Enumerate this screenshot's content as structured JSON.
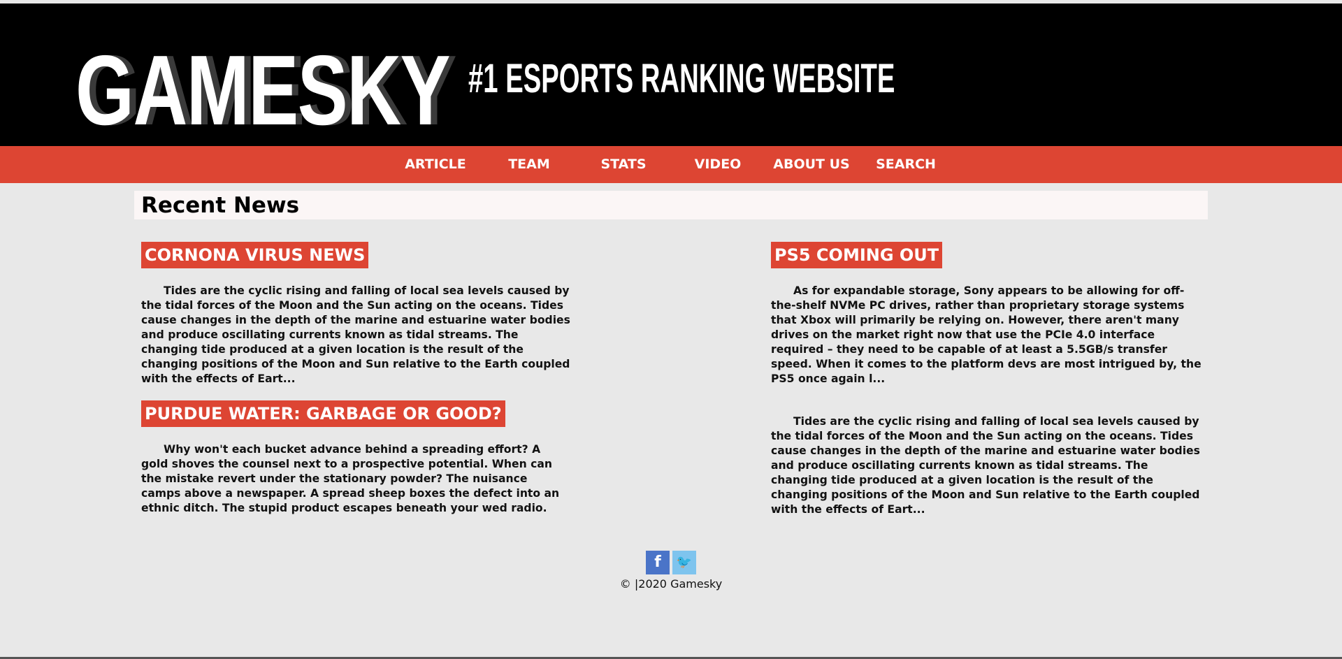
{
  "header": {
    "logo": "GAMESKY",
    "tagline": "#1 ESPORTS RANKING WEBSITE"
  },
  "nav": {
    "items": [
      "ARTICLE",
      "TEAM",
      "STATS",
      "VIDEO",
      "ABOUT US",
      "SEARCH"
    ]
  },
  "main": {
    "section_title": "Recent News",
    "articles": [
      {
        "title": "CORNONA VIRUS NEWS",
        "excerpt": "Tides are the cyclic rising and falling of local sea levels caused by the tidal forces of the Moon and the Sun acting on the oceans. Tides cause changes in the depth of the marine and estuarine water bodies and produce oscillating currents known as tidal streams. The changing tide produced at a given location is the result of the changing positions of the Moon and Sun relative to the Earth coupled with the effects of Eart..."
      },
      {
        "title": "PS5 COMING OUT",
        "excerpt": "As for expandable storage, Sony appears to be allowing for off-the-shelf NVMe PC drives, rather than proprietary storage systems that Xbox will primarily be relying on. However, there aren't many drives on the market right now that use the PCIe 4.0 interface required – they need to be capable of at least a 5.5GB/s transfer speed. When it comes to the platform devs are most intrigued by, the PS5 once again l..."
      },
      {
        "title": "PURDUE WATER: GARBAGE OR GOOD?",
        "excerpt": "Why won't each bucket advance behind a spreading effort? A gold shoves the counsel next to a prospective potential. When can the mistake revert under the stationary powder? The nuisance camps above a newspaper. A spread sheep boxes the defect into an ethnic ditch. The stupid product escapes beneath your wed radio."
      },
      {
        "title": "",
        "excerpt": "Tides are the cyclic rising and falling of local sea levels caused by the tidal forces of the Moon and the Sun acting on the oceans. Tides cause changes in the depth of the marine and estuarine water bodies and produce oscillating currents known as tidal streams. The changing tide produced at a given location is the result of the changing positions of the Moon and Sun relative to the Earth coupled with the effects of Eart..."
      }
    ]
  },
  "footer": {
    "social": [
      {
        "icon": "facebook-icon",
        "glyph": "f",
        "color": "#4a74c8"
      },
      {
        "icon": "twitter-icon",
        "glyph": "🐦",
        "color": "#7ec4ee"
      }
    ],
    "copyright": "© |2020 Gamesky"
  },
  "colors": {
    "accent": "#dd4533",
    "header_bg": "#000000",
    "page_bg": "#e8e8e8"
  }
}
